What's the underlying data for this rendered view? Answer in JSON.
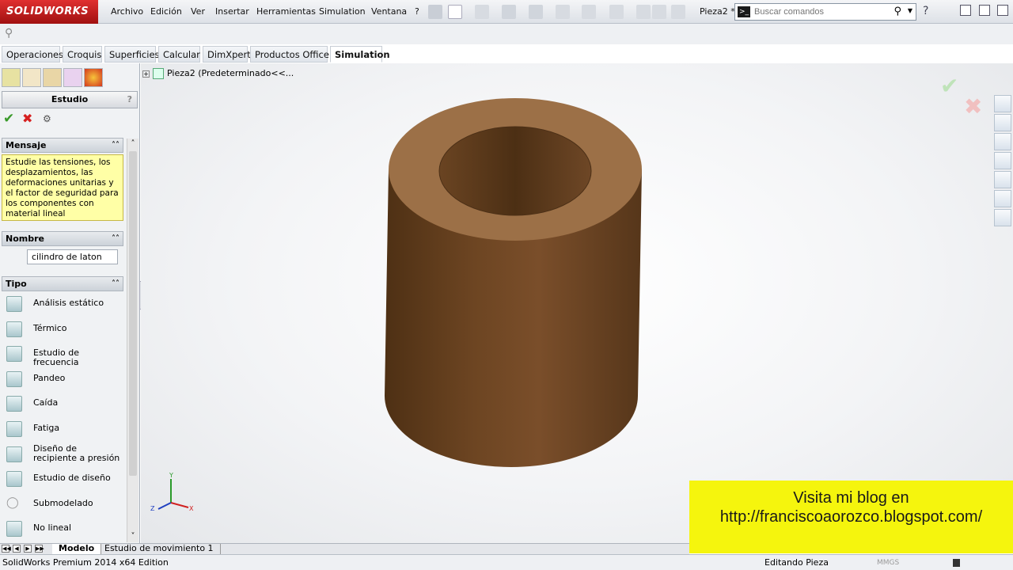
{
  "app": {
    "logo_text": "SOLIDWORKS",
    "doc_title": "Pieza2 *",
    "brand_color": "#c4161c"
  },
  "menubar": {
    "items": [
      "Archivo",
      "Edición",
      "Ver",
      "Insertar",
      "Herramientas",
      "Simulation",
      "Ventana",
      "?"
    ]
  },
  "search": {
    "placeholder": "Buscar comandos"
  },
  "command_tabs": [
    "Operaciones",
    "Croquis",
    "Superficies",
    "Calcular",
    "DimXpert",
    "Productos Office",
    "Simulation"
  ],
  "active_tab": "Simulation",
  "property_manager": {
    "title": "Estudio",
    "help": "?",
    "message_group": {
      "title": "Mensaje",
      "text": "Estudie las tensiones, los desplazamientos, las deformaciones unitarias y el factor de seguridad para los componentes con material lineal"
    },
    "name_group": {
      "title": "Nombre",
      "value": "cilindro de laton"
    },
    "type_group": {
      "title": "Tipo",
      "items": [
        {
          "label": "Análisis estático",
          "icon": "static-analysis-icon"
        },
        {
          "label": "Térmico",
          "icon": "thermal-icon"
        },
        {
          "label": "Estudio de frecuencia",
          "icon": "frequency-icon"
        },
        {
          "label": "Pandeo",
          "icon": "buckling-icon"
        },
        {
          "label": "Caída",
          "icon": "drop-test-icon"
        },
        {
          "label": "Fatiga",
          "icon": "fatigue-icon"
        },
        {
          "label": "Diseño de recipiente a presión",
          "icon": "pressure-vessel-icon"
        },
        {
          "label": "Estudio de diseño",
          "icon": "design-study-icon"
        },
        {
          "label": "Submodelado",
          "icon": "submodeling-icon"
        },
        {
          "label": "No lineal",
          "icon": "nonlinear-icon"
        }
      ]
    }
  },
  "viewport": {
    "tree_node": "Pieza2  (Predeterminado<<...",
    "part_color": "#7a4e2a"
  },
  "banner": {
    "line1": "Visita mi blog en",
    "line2": "http://franciscoaorozco.blogspot.com/",
    "color": "#f5f50d"
  },
  "bottom_tabs": [
    "Modelo",
    "Estudio de movimiento 1"
  ],
  "statusbar": {
    "left": "SolidWorks Premium 2014 x64 Edition",
    "middle": "Editando Pieza",
    "units": "MMGS"
  }
}
